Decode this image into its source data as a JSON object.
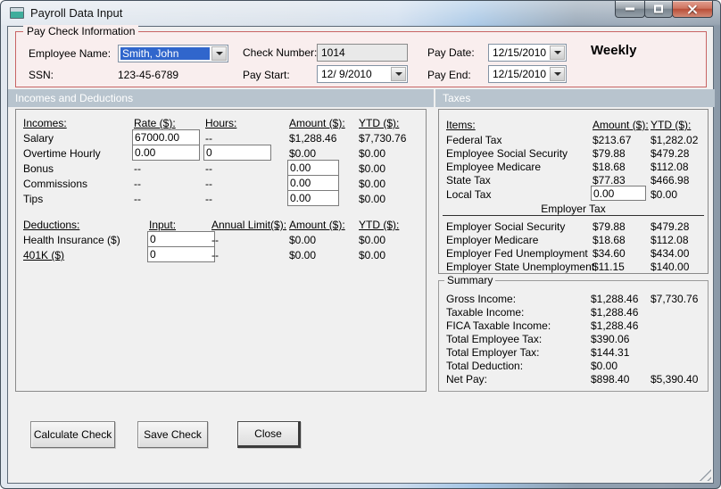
{
  "window": {
    "title": "Payroll Data Input"
  },
  "paycheck_info": {
    "legend": "Pay Check Information",
    "employee_name_label": "Employee Name:",
    "employee_name_value": "Smith, John",
    "ssn_label": "SSN:",
    "ssn_value": "123-45-6789",
    "check_number_label": "Check Number:",
    "check_number_value": "1014",
    "pay_start_label": "Pay Start:",
    "pay_start_value": "12/ 9/2010",
    "pay_date_label": "Pay Date:",
    "pay_date_value": "12/15/2010",
    "pay_end_label": "Pay End:",
    "pay_end_value": "12/15/2010",
    "frequency": "Weekly"
  },
  "incomes_panel": {
    "header": "Incomes and Deductions",
    "incomes": {
      "col_label": "Incomes:",
      "col_rate": "Rate ($):",
      "col_hours": "Hours:",
      "col_amount": "Amount ($):",
      "col_ytd": "YTD ($):",
      "rows": [
        {
          "label": "Salary",
          "rate": "67000.00",
          "hours": "--",
          "amount": "$1,288.46",
          "ytd": "$7,730.76"
        },
        {
          "label": "Overtime Hourly",
          "rate": "0.00",
          "hours": "0",
          "amount": "$0.00",
          "ytd": "$0.00"
        },
        {
          "label": "Bonus",
          "rate": "--",
          "hours": "--",
          "amount": "0.00",
          "ytd": "$0.00"
        },
        {
          "label": "Commissions",
          "rate": "--",
          "hours": "--",
          "amount": "0.00",
          "ytd": "$0.00"
        },
        {
          "label": "Tips",
          "rate": "--",
          "hours": "--",
          "amount": "0.00",
          "ytd": "$0.00"
        }
      ]
    },
    "deductions": {
      "col_label": "Deductions:",
      "col_input": "Input:",
      "col_limit": "Annual Limit($):",
      "col_amount": "Amount ($):",
      "col_ytd": "YTD ($):",
      "rows": [
        {
          "label": "Health Insurance  ($)",
          "input": "0",
          "limit": "--",
          "amount": "$0.00",
          "ytd": "$0.00"
        },
        {
          "label": "401K  ($)",
          "input": "0",
          "limit": "--",
          "amount": "$0.00",
          "ytd": "$0.00"
        }
      ]
    }
  },
  "taxes_panel": {
    "header": "Taxes",
    "col_items": "Items:",
    "col_amount": "Amount ($):",
    "col_ytd": "YTD ($):",
    "employee_rows": [
      {
        "label": "Federal Tax",
        "amount": "$213.67",
        "ytd": "$1,282.02"
      },
      {
        "label": "Employee Social Security",
        "amount": "$79.88",
        "ytd": "$479.28"
      },
      {
        "label": "Employee Medicare",
        "amount": "$18.68",
        "ytd": "$112.08"
      },
      {
        "label": "State Tax",
        "amount": "$77.83",
        "ytd": "$466.98"
      },
      {
        "label": "Local Tax",
        "amount": "0.00",
        "ytd": "$0.00"
      }
    ],
    "employer_section_label": "Employer Tax",
    "employer_rows": [
      {
        "label": "Employer Social Security",
        "amount": "$79.88",
        "ytd": "$479.28"
      },
      {
        "label": "Employer Medicare",
        "amount": "$18.68",
        "ytd": "$112.08"
      },
      {
        "label": "Employer Fed Unemployment",
        "amount": "$34.60",
        "ytd": "$434.00"
      },
      {
        "label": "Employer State Unemployment",
        "amount": "$11.15",
        "ytd": "$140.00"
      }
    ]
  },
  "summary": {
    "legend": "Summary",
    "rows": [
      {
        "label": "Gross Income:",
        "amount": "$1,288.46",
        "ytd": "$7,730.76"
      },
      {
        "label": "Taxable Income:",
        "amount": "$1,288.46",
        "ytd": ""
      },
      {
        "label": "FICA Taxable Income:",
        "amount": "$1,288.46",
        "ytd": ""
      },
      {
        "label": "Total Employee Tax:",
        "amount": "$390.06",
        "ytd": ""
      },
      {
        "label": "Total Employer Tax:",
        "amount": "$144.31",
        "ytd": ""
      },
      {
        "label": "Total Deduction:",
        "amount": "$0.00",
        "ytd": ""
      },
      {
        "label": "Net Pay:",
        "amount": "$898.40",
        "ytd": "$5,390.40"
      }
    ]
  },
  "buttons": {
    "calculate": "Calculate Check",
    "save": "Save Check",
    "close": "Close"
  },
  "colors": {
    "paycheck_border": "#c86464",
    "paycheck_bg": "#f9eeee",
    "panel_header_bg": "#b8c4ce",
    "selection_blue": "#3066cc",
    "close_button_red": "#b94e38",
    "client_bg": "#f0f0f0"
  }
}
